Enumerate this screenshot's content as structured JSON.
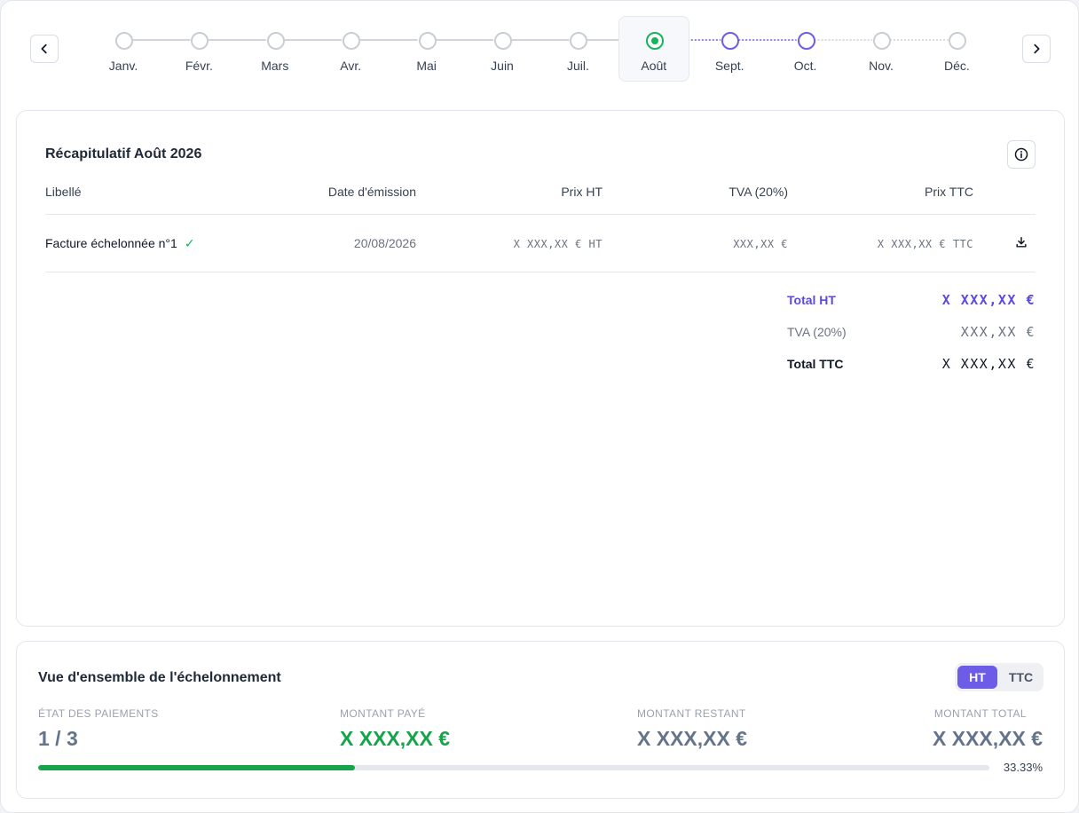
{
  "timeline": {
    "months": [
      {
        "label": "Janv.",
        "state": "past"
      },
      {
        "label": "Févr.",
        "state": "past"
      },
      {
        "label": "Mars",
        "state": "past"
      },
      {
        "label": "Avr.",
        "state": "past"
      },
      {
        "label": "Mai",
        "state": "past"
      },
      {
        "label": "Juin",
        "state": "past"
      },
      {
        "label": "Juil.",
        "state": "past"
      },
      {
        "label": "Août",
        "state": "current"
      },
      {
        "label": "Sept.",
        "state": "future"
      },
      {
        "label": "Oct.",
        "state": "future"
      },
      {
        "label": "Nov.",
        "state": "past"
      },
      {
        "label": "Déc.",
        "state": "past"
      }
    ],
    "selected_index": 7
  },
  "summary": {
    "title": "Récapitulatif Août 2026",
    "columns": {
      "label": "Libellé",
      "date": "Date d'émission",
      "ht": "Prix HT",
      "tva": "TVA (20%)",
      "ttc": "Prix TTC"
    },
    "rows": [
      {
        "label": "Facture échelonnée n°1",
        "date": "20/08/2026",
        "ht": "X XXX,XX € HT",
        "tva": "XXX,XX €",
        "ttc": "X XXX,XX € TTC"
      }
    ],
    "totals": {
      "ht_label": "Total HT",
      "ht_value": "X XXX,XX €",
      "tva_label": "TVA (20%)",
      "tva_value": "XXX,XX €",
      "ttc_label": "Total TTC",
      "ttc_value": "X XXX,XX €"
    }
  },
  "overview": {
    "title": "Vue d'ensemble de l'échelonnement",
    "toggle": {
      "ht": "HT",
      "ttc": "TTC",
      "active": "HT"
    },
    "status_label": "ÉTAT DES PAIEMENTS",
    "status_value": "1 / 3",
    "paid_label": "MONTANT PAYÉ",
    "paid_value": "X XXX,XX €",
    "remaining_label": "MONTANT RESTANT",
    "remaining_value": "X XXX,XX €",
    "total_label": "MONTANT TOTAL",
    "total_value": "X XXX,XX €",
    "progress_percent": 33.33,
    "progress_text": "33.33%"
  },
  "colors": {
    "accent": "#6c5ce7",
    "success": "#16b45a",
    "paid": "#16a34a",
    "muted": "#64748b"
  },
  "icons": {
    "prev": "chevron-left-icon",
    "next": "chevron-right-icon",
    "info": "info-icon",
    "check": "check-icon",
    "download": "download-icon"
  }
}
